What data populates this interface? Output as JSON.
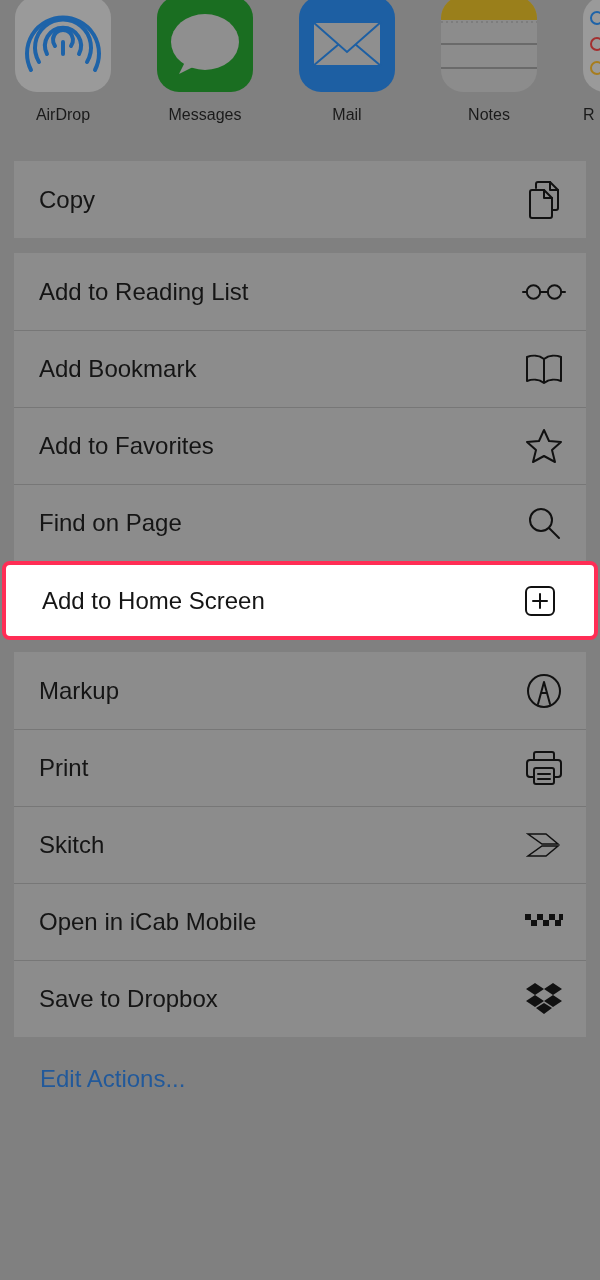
{
  "apps": [
    {
      "label": "AirDrop"
    },
    {
      "label": "Messages"
    },
    {
      "label": "Mail"
    },
    {
      "label": "Notes"
    },
    {
      "label": "R"
    }
  ],
  "groups": [
    {
      "rows": [
        {
          "label": "Copy",
          "highlighted": false
        }
      ]
    },
    {
      "rows": [
        {
          "label": "Add to Reading List",
          "highlighted": false
        },
        {
          "label": "Add Bookmark",
          "highlighted": false
        },
        {
          "label": "Add to Favorites",
          "highlighted": false
        },
        {
          "label": "Find on Page",
          "highlighted": false
        },
        {
          "label": "Add to Home Screen",
          "highlighted": true
        }
      ]
    },
    {
      "rows": [
        {
          "label": "Markup",
          "highlighted": false
        },
        {
          "label": "Print",
          "highlighted": false
        },
        {
          "label": "Skitch",
          "highlighted": false
        },
        {
          "label": "Open in iCab Mobile",
          "highlighted": false
        },
        {
          "label": "Save to Dropbox",
          "highlighted": false
        }
      ]
    }
  ],
  "footer_link": "Edit Actions..."
}
